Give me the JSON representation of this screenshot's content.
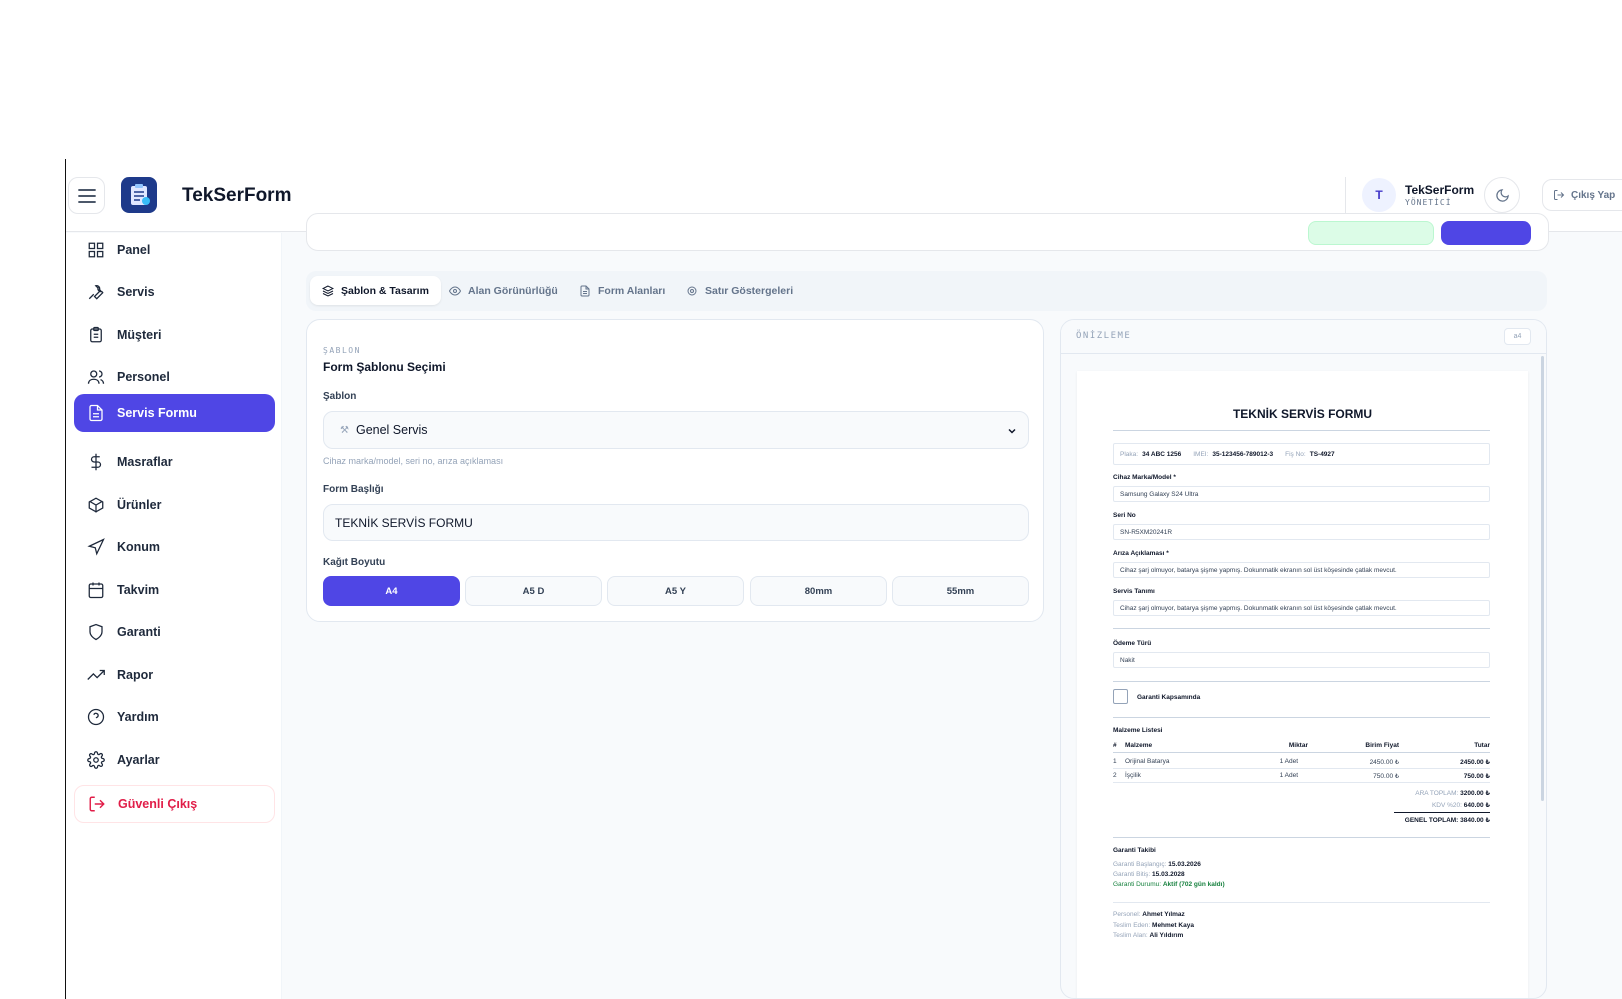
{
  "topbar": {
    "brand": "TekSerForm",
    "avatar_initial": "T",
    "user_name": "TekSerForm",
    "user_role": "YÖNETİCİ",
    "logout_label": "Çıkış Yap"
  },
  "sidebar": {
    "items": [
      {
        "label": "Panel",
        "icon": "grid-icon"
      },
      {
        "label": "Servis",
        "icon": "wrench-icon"
      },
      {
        "label": "Müşteri",
        "icon": "clipboard-icon"
      },
      {
        "label": "Personel",
        "icon": "users-icon"
      },
      {
        "label": "Servis Formu",
        "icon": "file-text-icon",
        "active": true
      },
      {
        "label": "Masraflar",
        "icon": "dollar-icon"
      },
      {
        "label": "Ürünler",
        "icon": "box-icon"
      },
      {
        "label": "Konum",
        "icon": "navigation-icon"
      },
      {
        "label": "Takvim",
        "icon": "calendar-icon"
      },
      {
        "label": "Garanti",
        "icon": "shield-icon"
      },
      {
        "label": "Rapor",
        "icon": "trending-up-icon"
      },
      {
        "label": "Yardım",
        "icon": "help-circle-icon"
      },
      {
        "label": "Ayarlar",
        "icon": "gear-icon"
      }
    ],
    "logout_label": "Güvenli Çıkış"
  },
  "tabs": [
    {
      "label": "Şablon & Tasarım",
      "icon": "layers-icon",
      "active": true
    },
    {
      "label": "Alan Görünürlüğü",
      "icon": "eye-icon"
    },
    {
      "label": "Form Alanları",
      "icon": "file-icon"
    },
    {
      "label": "Satır Göstergeleri",
      "icon": "gear-icon"
    }
  ],
  "template_card": {
    "eyebrow": "ŞABLON",
    "title": "Form Şablonu Seçimi",
    "template_label": "Şablon",
    "template_value": "Genel Servis",
    "template_hint": "Cihaz marka/model, seri no, arıza açıklaması",
    "form_title_label": "Form Başlığı",
    "form_title_value": "TEKNİK SERVİS FORMU",
    "paper_label": "Kağıt Boyutu",
    "paper_sizes": [
      {
        "label": "A4",
        "active": true
      },
      {
        "label": "A5 D"
      },
      {
        "label": "A5 Y"
      },
      {
        "label": "80mm"
      },
      {
        "label": "55mm"
      }
    ]
  },
  "preview": {
    "label": "ÖNİZLEME",
    "paper_badge": "a4",
    "doc": {
      "title": "TEKNİK SERVİS FORMU",
      "plate_label": "Plaka:",
      "plate_value": "34 ABC 1256",
      "imei_label": "IMEI:",
      "imei_value": "35-123456-789012-3",
      "receipt_label": "Fiş No:",
      "receipt_value": "TS-4927",
      "device_label": "Cihaz Marka/Model *",
      "device_value": "Samsung Galaxy S24 Ultra",
      "serial_label": "Seri No",
      "serial_value": "SN-R5XM20241R",
      "fault_label": "Arıza Açıklaması *",
      "fault_value": "Cihaz şarj olmuyor, batarya şişme yapmış. Dokunmatik ekranın sol üst köşesinde çatlak mevcut.",
      "service_label": "Servis Tanımı",
      "service_value": "Cihaz şarj olmuyor, batarya şişme yapmış. Dokunmatik ekranın sol üst köşesinde çatlak mevcut.",
      "payment_label": "Ödeme Türü",
      "payment_value": "Nakit",
      "warranty_check_label": "Garanti Kapsamında",
      "materials_title": "Malzeme Listesi",
      "materials_headers": [
        "#",
        "Malzeme",
        "Miktar",
        "Birim Fiyat",
        "Tutar"
      ],
      "materials_rows": [
        {
          "no": "1",
          "name": "Orijinal Batarya",
          "qty": "1 Adet",
          "unit": "2450.00 ₺",
          "total": "2450.00 ₺"
        },
        {
          "no": "2",
          "name": "İşçilik",
          "qty": "1 Adet",
          "unit": "750.00 ₺",
          "total": "750.00 ₺"
        }
      ],
      "subtotal_label": "ARA TOPLAM:",
      "subtotal_value": "3200.00 ₺",
      "vat_label": "KDV %20:",
      "vat_value": "640.00 ₺",
      "grand_label": "GENEL TOPLAM:",
      "grand_value": "3840.00 ₺",
      "warranty_title": "Garanti Takibi",
      "warranty_start_label": "Garanti Başlangıç:",
      "warranty_start_value": "15.03.2026",
      "warranty_end_label": "Garanti Bitiş:",
      "warranty_end_value": "15.03.2028",
      "warranty_status_label": "Garanti Durumu:",
      "warranty_status_value": "Aktif (702 gün kaldı)",
      "staff_label": "Personel:",
      "staff_value": "Ahmet Yılmaz",
      "delivered_by_label": "Teslim Eden:",
      "delivered_by_value": "Mehmet Kaya",
      "received_by_label": "Teslim Alan:",
      "received_by_value": "Ali Yıldırım"
    }
  },
  "colors": {
    "accent": "#4f46e5",
    "danger": "#e11d48",
    "success": "#15803d"
  }
}
